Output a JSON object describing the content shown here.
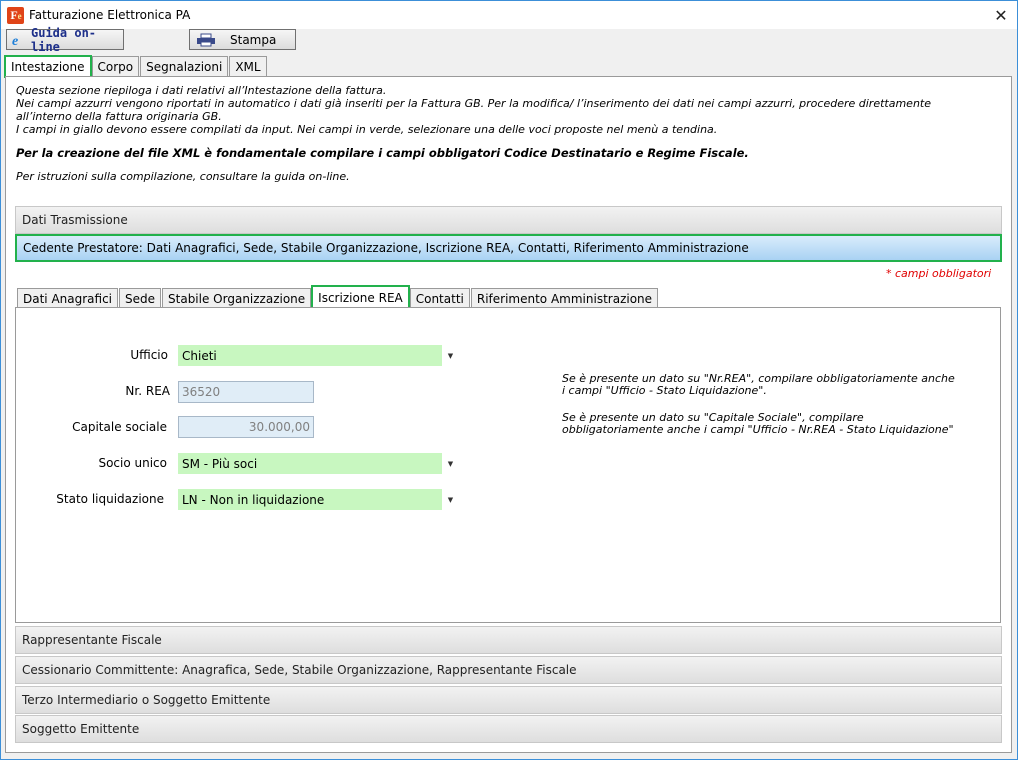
{
  "window": {
    "title": "Fatturazione Elettronica PA",
    "icon_letters": "F",
    "icon_sub": "e"
  },
  "toolbar": {
    "guida_label": "Guida on-line",
    "stampa_label": "Stampa"
  },
  "main_tabs": [
    "Intestazione",
    "Corpo",
    "Segnalazioni",
    "XML"
  ],
  "info": {
    "line1": "Questa sezione riepiloga i dati relativi all’Intestazione della fattura.",
    "line2": "Nei campi azzurri vengono riportati in automatico i dati già inseriti per la Fattura GB. Per la modifica/ l’inserimento dei dati nei campi azzurri, procedere direttamente",
    "line3": "all’interno della fattura originaria GB.",
    "line4": "I campi in giallo devono essere compilati da input. Nei campi in verde, selezionare una delle voci proposte nel menù a tendina.",
    "bold": "Per la creazione del file XML è fondamentale compilare i campi obbligatori Codice Destinatario e Regime Fiscale.",
    "guide": "Per istruzioni sulla compilazione, consultare la guida on-line."
  },
  "sections": {
    "dati_trasmissione": "Dati Trasmissione",
    "cedente": "Cedente Prestatore: Dati Anagrafici, Sede, Stabile Organizzazione, Iscrizione REA, Contatti, Riferimento Amministrazione",
    "rappresentante": "Rappresentante Fiscale",
    "cessionario": "Cessionario Committente: Anagrafica, Sede, Stabile Organizzazione, Rappresentante Fiscale",
    "terzo": "Terzo Intermediario o Soggetto Emittente",
    "soggetto": "Soggetto Emittente"
  },
  "required_note": "* campi obbligatori",
  "sub_tabs": [
    "Dati Anagrafici",
    "Sede",
    "Stabile Organizzazione",
    "Iscrizione REA",
    "Contatti",
    "Riferimento Amministrazione"
  ],
  "form": {
    "ufficio_label": "Ufficio",
    "ufficio_value": "Chieti",
    "nrea_label": "Nr. REA",
    "nrea_value": "36520",
    "capitale_label": "Capitale sociale",
    "capitale_value": "30.000,00",
    "socio_label": "Socio unico",
    "socio_value": "SM - Più soci",
    "stato_label": "Stato liquidazione",
    "stato_value": "LN - Non in liquidazione"
  },
  "notes": {
    "n1a": "Se è presente un dato su \"Nr.REA\", compilare obbligatoriamente anche",
    "n1b": "i campi \"Ufficio - Stato Liquidazione\".",
    "n2a": "Se è presente un dato su \"Capitale Sociale\", compilare",
    "n2b": "obbligatoriamente anche i campi \"Ufficio - Nr.REA - Stato Liquidazione\""
  },
  "colors": {
    "select_green": "#c8f7c0",
    "readonly_blue": "#e0edf7",
    "highlight_green": "#22b14c",
    "required_red": "#e00000"
  }
}
